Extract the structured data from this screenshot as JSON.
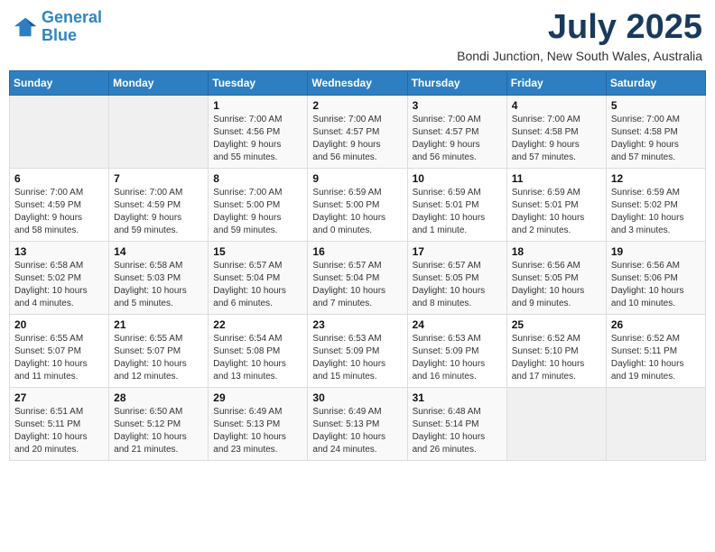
{
  "logo": {
    "line1": "General",
    "line2": "Blue"
  },
  "title": "July 2025",
  "location": "Bondi Junction, New South Wales, Australia",
  "days_of_week": [
    "Sunday",
    "Monday",
    "Tuesday",
    "Wednesday",
    "Thursday",
    "Friday",
    "Saturday"
  ],
  "weeks": [
    [
      {
        "day": "",
        "info": ""
      },
      {
        "day": "",
        "info": ""
      },
      {
        "day": "1",
        "info": "Sunrise: 7:00 AM\nSunset: 4:56 PM\nDaylight: 9 hours\nand 55 minutes."
      },
      {
        "day": "2",
        "info": "Sunrise: 7:00 AM\nSunset: 4:57 PM\nDaylight: 9 hours\nand 56 minutes."
      },
      {
        "day": "3",
        "info": "Sunrise: 7:00 AM\nSunset: 4:57 PM\nDaylight: 9 hours\nand 56 minutes."
      },
      {
        "day": "4",
        "info": "Sunrise: 7:00 AM\nSunset: 4:58 PM\nDaylight: 9 hours\nand 57 minutes."
      },
      {
        "day": "5",
        "info": "Sunrise: 7:00 AM\nSunset: 4:58 PM\nDaylight: 9 hours\nand 57 minutes."
      }
    ],
    [
      {
        "day": "6",
        "info": "Sunrise: 7:00 AM\nSunset: 4:59 PM\nDaylight: 9 hours\nand 58 minutes."
      },
      {
        "day": "7",
        "info": "Sunrise: 7:00 AM\nSunset: 4:59 PM\nDaylight: 9 hours\nand 59 minutes."
      },
      {
        "day": "8",
        "info": "Sunrise: 7:00 AM\nSunset: 5:00 PM\nDaylight: 9 hours\nand 59 minutes."
      },
      {
        "day": "9",
        "info": "Sunrise: 6:59 AM\nSunset: 5:00 PM\nDaylight: 10 hours\nand 0 minutes."
      },
      {
        "day": "10",
        "info": "Sunrise: 6:59 AM\nSunset: 5:01 PM\nDaylight: 10 hours\nand 1 minute."
      },
      {
        "day": "11",
        "info": "Sunrise: 6:59 AM\nSunset: 5:01 PM\nDaylight: 10 hours\nand 2 minutes."
      },
      {
        "day": "12",
        "info": "Sunrise: 6:59 AM\nSunset: 5:02 PM\nDaylight: 10 hours\nand 3 minutes."
      }
    ],
    [
      {
        "day": "13",
        "info": "Sunrise: 6:58 AM\nSunset: 5:02 PM\nDaylight: 10 hours\nand 4 minutes."
      },
      {
        "day": "14",
        "info": "Sunrise: 6:58 AM\nSunset: 5:03 PM\nDaylight: 10 hours\nand 5 minutes."
      },
      {
        "day": "15",
        "info": "Sunrise: 6:57 AM\nSunset: 5:04 PM\nDaylight: 10 hours\nand 6 minutes."
      },
      {
        "day": "16",
        "info": "Sunrise: 6:57 AM\nSunset: 5:04 PM\nDaylight: 10 hours\nand 7 minutes."
      },
      {
        "day": "17",
        "info": "Sunrise: 6:57 AM\nSunset: 5:05 PM\nDaylight: 10 hours\nand 8 minutes."
      },
      {
        "day": "18",
        "info": "Sunrise: 6:56 AM\nSunset: 5:05 PM\nDaylight: 10 hours\nand 9 minutes."
      },
      {
        "day": "19",
        "info": "Sunrise: 6:56 AM\nSunset: 5:06 PM\nDaylight: 10 hours\nand 10 minutes."
      }
    ],
    [
      {
        "day": "20",
        "info": "Sunrise: 6:55 AM\nSunset: 5:07 PM\nDaylight: 10 hours\nand 11 minutes."
      },
      {
        "day": "21",
        "info": "Sunrise: 6:55 AM\nSunset: 5:07 PM\nDaylight: 10 hours\nand 12 minutes."
      },
      {
        "day": "22",
        "info": "Sunrise: 6:54 AM\nSunset: 5:08 PM\nDaylight: 10 hours\nand 13 minutes."
      },
      {
        "day": "23",
        "info": "Sunrise: 6:53 AM\nSunset: 5:09 PM\nDaylight: 10 hours\nand 15 minutes."
      },
      {
        "day": "24",
        "info": "Sunrise: 6:53 AM\nSunset: 5:09 PM\nDaylight: 10 hours\nand 16 minutes."
      },
      {
        "day": "25",
        "info": "Sunrise: 6:52 AM\nSunset: 5:10 PM\nDaylight: 10 hours\nand 17 minutes."
      },
      {
        "day": "26",
        "info": "Sunrise: 6:52 AM\nSunset: 5:11 PM\nDaylight: 10 hours\nand 19 minutes."
      }
    ],
    [
      {
        "day": "27",
        "info": "Sunrise: 6:51 AM\nSunset: 5:11 PM\nDaylight: 10 hours\nand 20 minutes."
      },
      {
        "day": "28",
        "info": "Sunrise: 6:50 AM\nSunset: 5:12 PM\nDaylight: 10 hours\nand 21 minutes."
      },
      {
        "day": "29",
        "info": "Sunrise: 6:49 AM\nSunset: 5:13 PM\nDaylight: 10 hours\nand 23 minutes."
      },
      {
        "day": "30",
        "info": "Sunrise: 6:49 AM\nSunset: 5:13 PM\nDaylight: 10 hours\nand 24 minutes."
      },
      {
        "day": "31",
        "info": "Sunrise: 6:48 AM\nSunset: 5:14 PM\nDaylight: 10 hours\nand 26 minutes."
      },
      {
        "day": "",
        "info": ""
      },
      {
        "day": "",
        "info": ""
      }
    ]
  ]
}
